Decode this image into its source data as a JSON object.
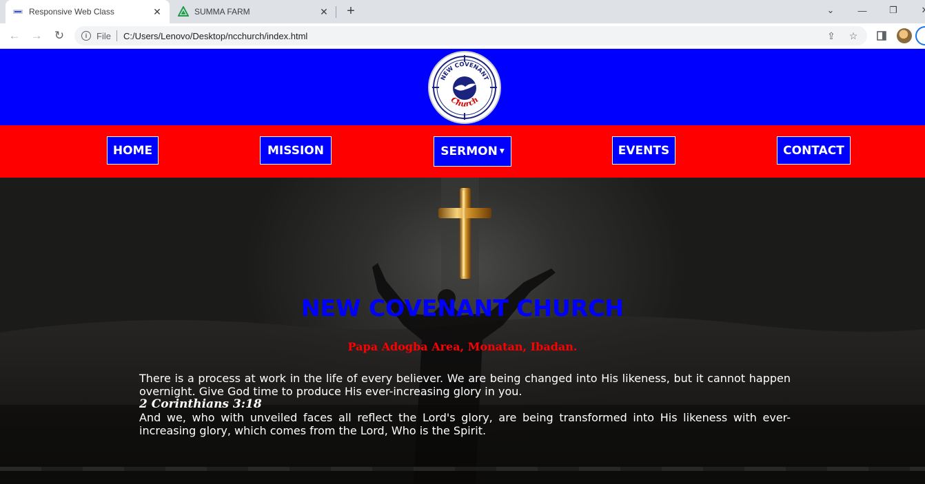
{
  "browser": {
    "tabs": [
      {
        "title": "Responsive Web Class",
        "icon": "responsive-class-favicon",
        "active": true
      },
      {
        "title": "SUMMA FARM",
        "icon": "summa-farm-favicon",
        "active": false
      }
    ],
    "address": {
      "scheme_label": "File",
      "url": "C:/Users/Lenovo/Desktop/ncchurch/index.html"
    }
  },
  "site": {
    "logo": {
      "top_text": "NEW COVENANT",
      "script_text": "Church"
    },
    "nav": [
      {
        "label": "HOME"
      },
      {
        "label": "MISSION"
      },
      {
        "label": "SERMON",
        "has_dropdown": true
      },
      {
        "label": "EVENTS"
      },
      {
        "label": "CONTACT"
      }
    ],
    "hero": {
      "title": "NEW COVENANT CHURCH",
      "address": "Papa Adogba Area, Monatan, Ibadan.",
      "paragraph1": "There is a process at work in the life of every believer. We are being changed into His likeness, but it cannot happen overnight. Give God time to produce His ever-increasing glory in you.",
      "reference": "2 Corinthians 3:18",
      "paragraph2": "And we, who with unveiled faces all reflect the Lord's glory, are being transformed into His likeness with ever-increasing glory, which comes from the Lord, Who is the Spirit."
    }
  },
  "colors": {
    "header_blue": "#0000ff",
    "nav_red": "#ff0000",
    "title_blue": "#0000ff",
    "address_red": "#ff0000"
  }
}
